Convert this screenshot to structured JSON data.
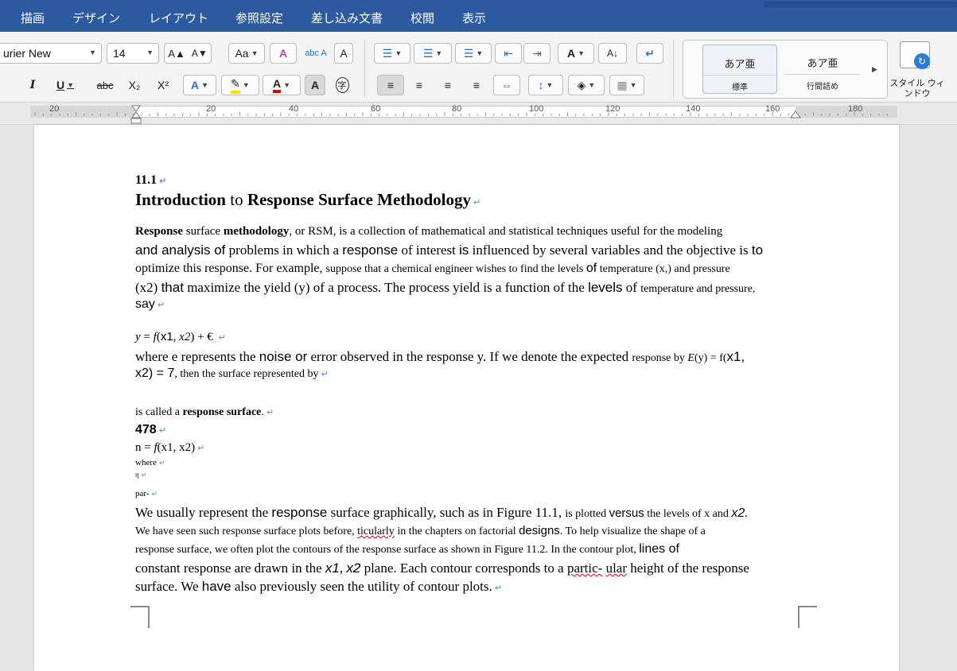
{
  "menu": {
    "tabs": [
      "描画",
      "デザイン",
      "レイアウト",
      "参照設定",
      "差し込み文書",
      "校閲",
      "表示"
    ]
  },
  "ribbon": {
    "font_name": "urier New",
    "font_size": "14",
    "icons": {
      "grow": "A▲",
      "shrink": "A▼",
      "case": "Aa",
      "clear": "A",
      "phonetic": "abc A",
      "border_char": "A",
      "bold": "B",
      "italic": "I",
      "underline": "U",
      "strike": "abc",
      "subscript": "X₂",
      "superscript": "X²",
      "text_effects": "A",
      "highlight": "✎",
      "font_color": "A",
      "shade_char": "A",
      "enclose": "字",
      "bullets": "☰",
      "numbering": "☰",
      "multilevel": "☰",
      "dec_indent": "⇤",
      "inc_indent": "⇥",
      "asian_layout": "A",
      "sort": "A↓",
      "show_marks": "↵",
      "align_left": "≡",
      "center": "≡",
      "align_right": "≡",
      "justify": "≡",
      "distributed": "⇔",
      "line_spacing": "↕",
      "shading": "◈",
      "borders": "▦"
    },
    "styles": [
      {
        "preview": "あア亜",
        "name": "標準"
      },
      {
        "preview": "あア亜",
        "name": "行間詰め"
      }
    ],
    "style_window_label": "スタイル ウィンドウ"
  },
  "ruler": {
    "numbers": [
      "20",
      "20",
      "40",
      "60",
      "80",
      "100",
      "120",
      "140",
      "160",
      "180"
    ]
  },
  "document": {
    "section_number": "11.1",
    "title_b1": "Introduction",
    "title_mid": " to ",
    "title_b2": "Response Surface Methodology",
    "p1l1_a": "Response",
    "p1l1_b": " surface ",
    "p1l1_c": "methodology",
    "p1l1_d": ", or RSM, is a collection of mathematical and statistical techniques useful for the modeling",
    "p1l2_a": "and analysis of",
    "p1l2_b": " problems in which a ",
    "p1l2_c": "response",
    "p1l2_d": " of interest ",
    "p1l2_e": "is",
    "p1l2_f": " influenced by several variables and the objective is ",
    "p1l2_g": "to",
    "p1l3_a": "optimize this response. For example, ",
    "p1l3_b": "suppose that a chemical engineer wishes to find the levels ",
    "p1l3_c": "of",
    "p1l3_d": " temperature (x,) and pressure",
    "p1l4_a": "(x2) ",
    "p1l4_b": "that",
    "p1l4_c": " maximize the yield (y) of a process. The process yield is a function of the ",
    "p1l4_d": "levels",
    "p1l4_e": " of ",
    "p1l4_f": "temperature and pressure,",
    "p1l5": "say",
    "eq1_a": "y",
    "eq1_b": " = ",
    "eq1_c": "f",
    "eq1_d": "(",
    "eq1_e": "x1",
    "eq1_f": ", ",
    "eq1_g": "x2",
    "eq1_h": ") + € ",
    "p2l1_a": "where e represents the ",
    "p2l1_b": "noise or",
    "p2l1_c": " error observed in the response y. If we denote the expected ",
    "p2l1_d": "response by ",
    "p2l1_e": "E",
    "p2l1_f": "(y) = f(",
    "p2l1_g": "x1,",
    "p2l2_a": "x2) = 7",
    "p2l2_b": ", then the surface represented by",
    "p3_a": "is called a ",
    "p3_b": "response surface",
    "p3_c": ".",
    "page_num": "478",
    "eq2_a": "n = ",
    "eq2_b": "f",
    "eq2_c": "(x1, x2)",
    "where": "where",
    "eta": "η",
    "par": "par-",
    "p4l1_a": "We usually represent the ",
    "p4l1_b": "response",
    "p4l1_c": " surface graphically, such as in Figure 11.1, ",
    "p4l1_d": "is plotted ",
    "p4l1_e": "versus",
    "p4l1_f": " the levels of x and ",
    "p4l1_g": "x2.",
    "p4l2_a": "We have seen such response surface plots before, ",
    "p4l2_b": "ticularly",
    "p4l2_c": " in the chapters on factorial ",
    "p4l2_d": "designs",
    "p4l2_e": ". To help visualize the shape of a",
    "p4l3_a": "response surface, we often plot the contours of the response surface as shown in Figure 11.2. In the contour plot, ",
    "p4l3_b": "lines of",
    "p4l4_a": "constant response are drawn in the ",
    "p4l4_b": "x1",
    "p4l4_c": ", ",
    "p4l4_d": "x2",
    "p4l4_e": " plane. Each contour corresponds to a ",
    "p4l4_f": "partic-",
    "p4l4_g": " ",
    "p4l4_h": "ular",
    "p4l4_i": " height of the response",
    "p4l5_a": "surface. We ",
    "p4l5_b": "have",
    "p4l5_c": " also previously seen the utility of contour plots.",
    "para_mark": "↵"
  },
  "colors": {
    "accent": "#2c5aa0",
    "para_mark": "#4a90e2",
    "spell_underline": "#d0021b",
    "highlight": "#f4e400",
    "font_color": "#e00000"
  }
}
